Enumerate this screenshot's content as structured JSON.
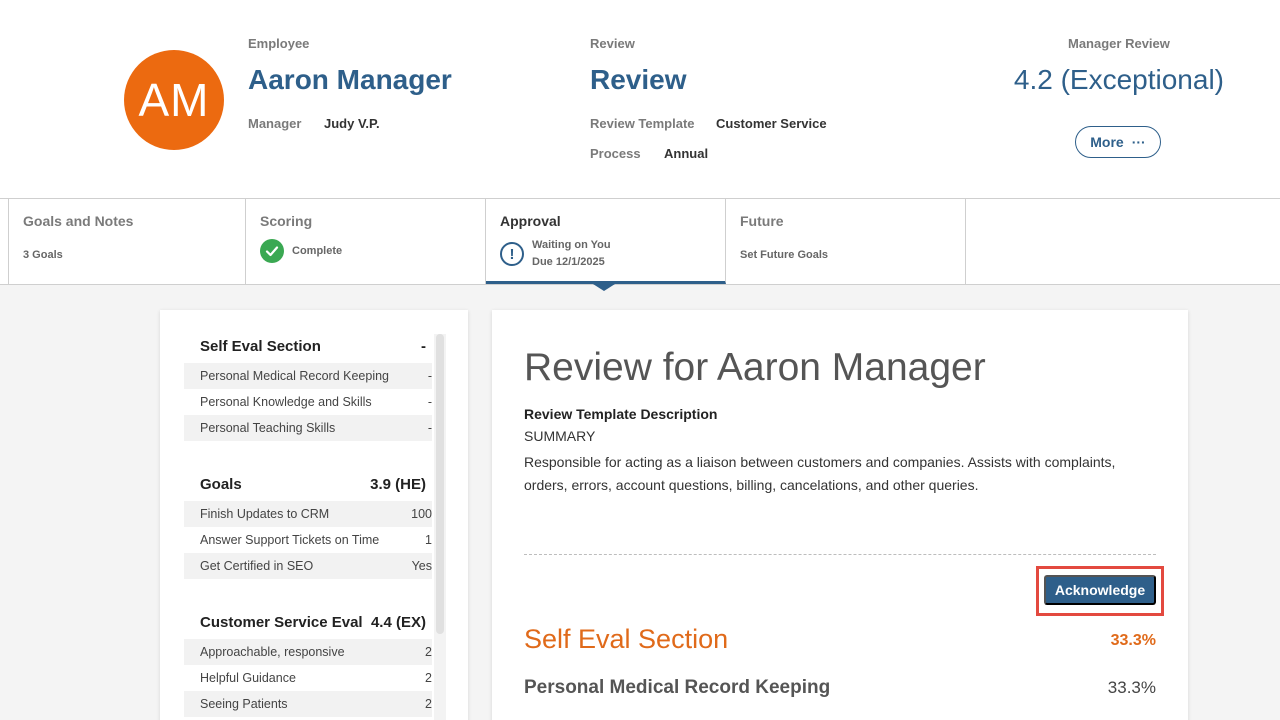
{
  "header": {
    "avatar_initials": "AM",
    "employee_label": "Employee",
    "employee_name": "Aaron Manager",
    "manager_label": "Manager",
    "manager_name": "Judy V.P.",
    "review_label": "Review",
    "review_title": "Review",
    "template_label": "Review Template",
    "template_value": "Customer Service",
    "process_label": "Process",
    "process_value": "Annual",
    "manager_review_label": "Manager Review",
    "manager_review_score": "4.2 (Exceptional)",
    "more_label": "More",
    "more_glyph": "···"
  },
  "tabs": [
    {
      "title": "Goals and Notes",
      "sub": "3 Goals"
    },
    {
      "title": "Scoring",
      "sub": "Complete"
    },
    {
      "title": "Approval",
      "sub1": "Waiting on You",
      "sub2": "Due 12/1/2025"
    },
    {
      "title": "Future",
      "sub": "Set Future Goals"
    }
  ],
  "sidebar": {
    "sections": [
      {
        "title": "Self Eval Section",
        "score": "-",
        "items": [
          {
            "label": "Personal Medical Record Keeping",
            "value": "-"
          },
          {
            "label": "Personal Knowledge and Skills",
            "value": "-"
          },
          {
            "label": "Personal Teaching Skills",
            "value": "-"
          }
        ]
      },
      {
        "title": "Goals",
        "score": "3.9 (HE)",
        "items": [
          {
            "label": "Finish Updates to CRM",
            "value": "100"
          },
          {
            "label": "Answer Support Tickets on Time",
            "value": "1"
          },
          {
            "label": "Get Certified in SEO",
            "value": "Yes"
          }
        ]
      },
      {
        "title": "Customer Service Eval",
        "score": "4.4 (EX)",
        "items": [
          {
            "label": "Approachable, responsive",
            "value": "2"
          },
          {
            "label": "Helpful Guidance",
            "value": "2"
          },
          {
            "label": "Seeing Patients",
            "value": "2"
          }
        ]
      }
    ]
  },
  "main": {
    "title": "Review for Aaron Manager",
    "desc_heading": "Review Template Description",
    "summary": "SUMMARY",
    "text": "Responsible for acting as a liaison between customers and companies. Assists with complaints, orders, errors, account questions, billing, cancelations, and other queries.",
    "ack_label": "Acknowledge",
    "section_title": "Self Eval Section",
    "section_pct": "33.3%",
    "item_title": "Personal Medical Record Keeping",
    "item_pct": "33.3%"
  },
  "colors": {
    "accent": "#2e5f8a",
    "avatar": "#ec6a10",
    "section_orange": "#e06a1a",
    "highlight": "#e3493f",
    "complete_green": "#3aa852"
  }
}
